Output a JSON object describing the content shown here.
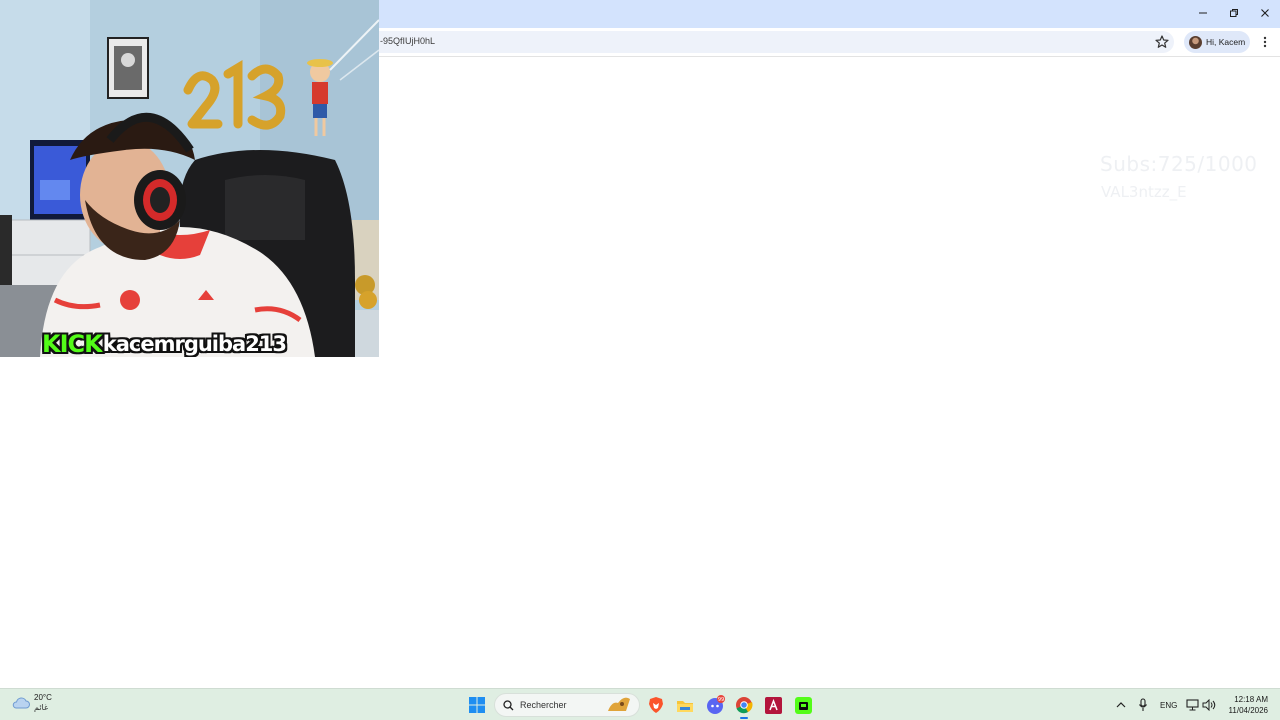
{
  "browser": {
    "url_fragment": "-95QfIUjH0hL",
    "profile_label": "Hi, Kacem"
  },
  "stream": {
    "platform_logo": "KICK",
    "username": "kacemrguiba213",
    "subs_counter": "Subs:725/1000",
    "last_sub": "VAL3ntzz_E"
  },
  "taskbar": {
    "weather_temp": "20°C",
    "weather_condition": "غائم",
    "search_placeholder": "Rechercher",
    "discord_badge": "99",
    "language": "ENG",
    "time": "12:18 AM",
    "date": "11/04/2026"
  },
  "colors": {
    "titlebar": "#d3e3fd",
    "kick_green": "#53fc18",
    "taskbar": "#dfeee2"
  }
}
